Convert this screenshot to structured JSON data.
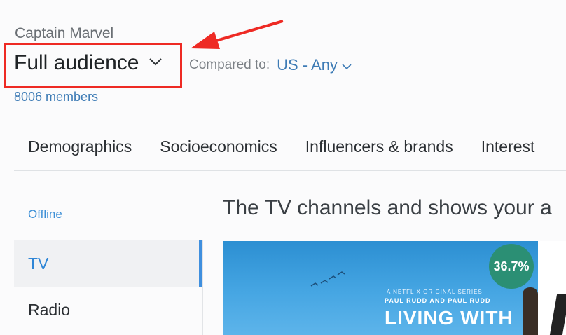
{
  "header": {
    "title": "Captain Marvel",
    "audience": "Full audience",
    "compared_label": "Compared to:",
    "compared_value": "US - Any",
    "members": "8006 members"
  },
  "tabs": [
    "Demographics",
    "Socioeconomics",
    "Influencers & brands",
    "Interest"
  ],
  "sidebar": {
    "section_label": "Offline",
    "items": [
      {
        "label": "TV",
        "active": true
      },
      {
        "label": "Radio",
        "active": false
      }
    ]
  },
  "main": {
    "heading": "The TV channels and shows your a",
    "card": {
      "percent": "36.7%",
      "tagline": "A NETFLIX ORIGINAL SERIES",
      "names": "PAUL RUDD AND PAUL RUDD",
      "title": "LIVING WITH"
    }
  },
  "colors": {
    "accent_blue": "#3d7bb5",
    "annotation_red": "#ee2a24",
    "badge_green": "#2b8f74"
  },
  "icons": {
    "audience_chevron": "chevron-down-icon",
    "compared_chevron": "chevron-down-icon",
    "annotation_arrow": "arrow-icon"
  }
}
